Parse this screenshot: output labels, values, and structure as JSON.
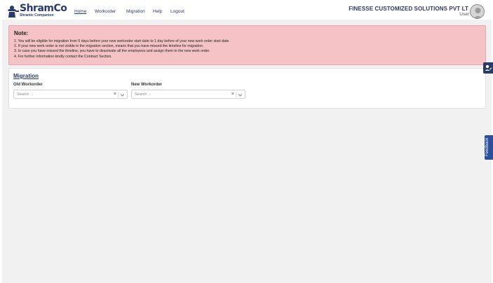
{
  "header": {
    "brand": "ShramCo",
    "tagline": "Shramic Companion",
    "nav": [
      "Home",
      "Workorder",
      "Migration",
      "Help",
      "Logout"
    ],
    "company": "FINESSE CUSTOMIZED SOLUTIONS PVT LT",
    "role": "User"
  },
  "note": {
    "title": "Note:",
    "lines": [
      "1. You will be eligible for migration from 5 days before your new workorder start date to 1 day before of your new work order start date.",
      "2. If your new work order is not visible in the migration section, means that you have missed the timeline for migration.",
      "3. In case you have missed the timeline, you have to deactivate all the employees and assign them to the new work order.",
      "4. For further information kindly contact the Contract Section."
    ]
  },
  "migration": {
    "title": "Migration",
    "old_label": "Old Workorder",
    "new_label": "New Workorder",
    "old_placeholder": "Search ...",
    "new_placeholder": "Search ...",
    "clear_symbol": "×"
  },
  "feedback_label": "Feedback",
  "colors": {
    "brand": "#2a3b6b",
    "note_bg": "#f5c2c6",
    "feedback": "#2a4f9b"
  }
}
